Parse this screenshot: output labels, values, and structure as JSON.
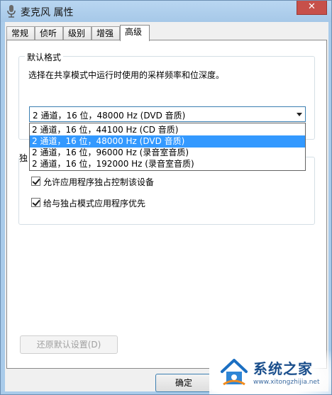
{
  "window": {
    "title": "麦克风 属性",
    "close_label": "✕"
  },
  "tabs": [
    {
      "label": "常规"
    },
    {
      "label": "侦听"
    },
    {
      "label": "级别"
    },
    {
      "label": "增强"
    },
    {
      "label": "高级",
      "active": true
    }
  ],
  "default_format": {
    "group_title": "默认格式",
    "description": "选择在共享模式中运行时使用的采样频率和位深度。",
    "selected_value": "2 通道，16 位，48000 Hz (DVD 音质)",
    "options": [
      "2 通道，16 位，44100 Hz (CD 音质)",
      "2 通道，16 位，48000 Hz (DVD 音质)",
      "2 通道，16 位，96000 Hz (录音室音质)",
      "2 通道，16 位，192000 Hz (录音室音质)"
    ],
    "highlighted_index": 1
  },
  "exclusive_mode": {
    "group_title_partial": "独",
    "checkbox1_label": "允许应用程序独占控制该设备",
    "checkbox1_checked": true,
    "checkbox2_label": "给与独占模式应用程序优先",
    "checkbox2_checked": true
  },
  "buttons": {
    "restore_defaults": "还原默认设置(D)",
    "ok": "确定"
  },
  "watermark": {
    "text": "系统之家",
    "url": "www.xitongzhijia.net"
  },
  "colors": {
    "selection": "#3399ff",
    "titlebar": "#a6c8e8",
    "close": "#c7504a"
  }
}
